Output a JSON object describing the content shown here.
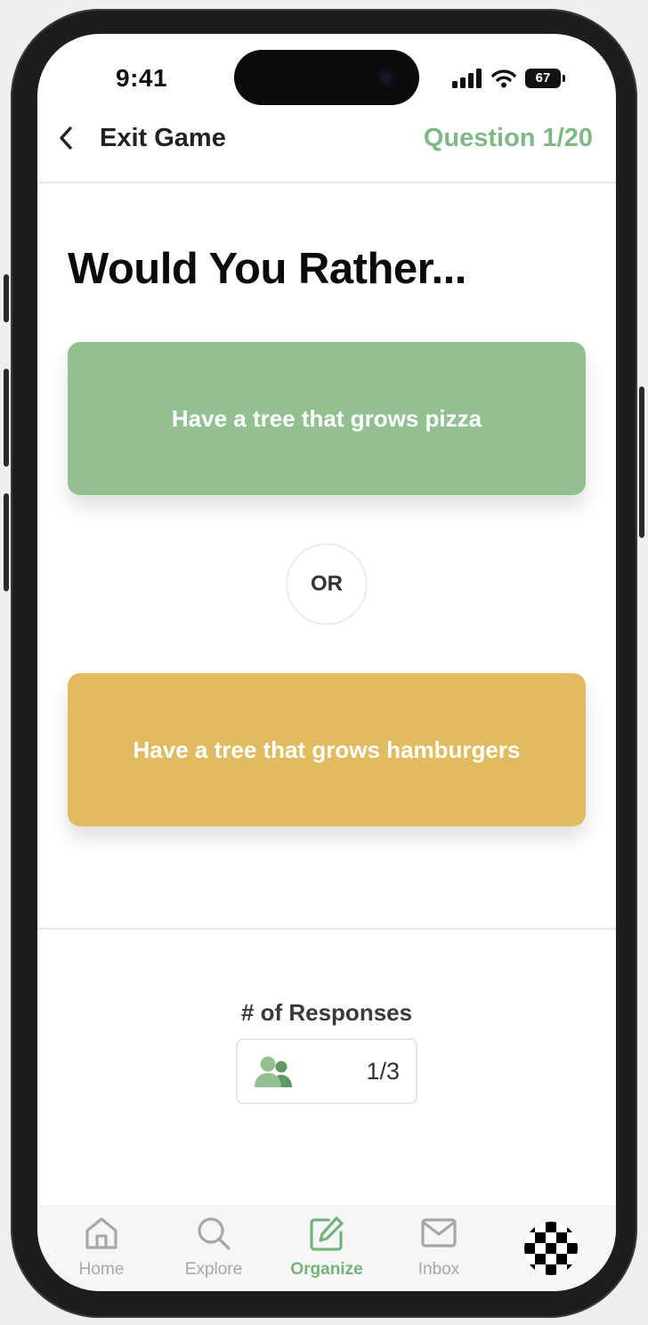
{
  "status_bar": {
    "time": "9:41",
    "battery": "67",
    "icons": [
      "signal-icon",
      "wifi-icon",
      "battery-icon"
    ]
  },
  "header": {
    "back_label": "Exit Game",
    "question_counter": "Question 1/20"
  },
  "game": {
    "title": "Would You Rather...",
    "option_a": "Have a tree that grows pizza",
    "or_label": "OR",
    "option_b": "Have a tree that grows hamburgers",
    "option_a_color": "#93c090",
    "option_b_color": "#e0bb5f"
  },
  "responses": {
    "label": "# of Responses",
    "count": "1/3",
    "icon": "users-icon"
  },
  "tab_bar": {
    "accent_color": "#76b27c",
    "tabs": [
      {
        "label": "Home",
        "icon": "home-icon",
        "active": false
      },
      {
        "label": "Explore",
        "icon": "search-icon",
        "active": false
      },
      {
        "label": "Organize",
        "icon": "edit-icon",
        "active": true
      },
      {
        "label": "Inbox",
        "icon": "mail-icon",
        "active": false
      }
    ],
    "avatar": "checkered-avatar"
  }
}
